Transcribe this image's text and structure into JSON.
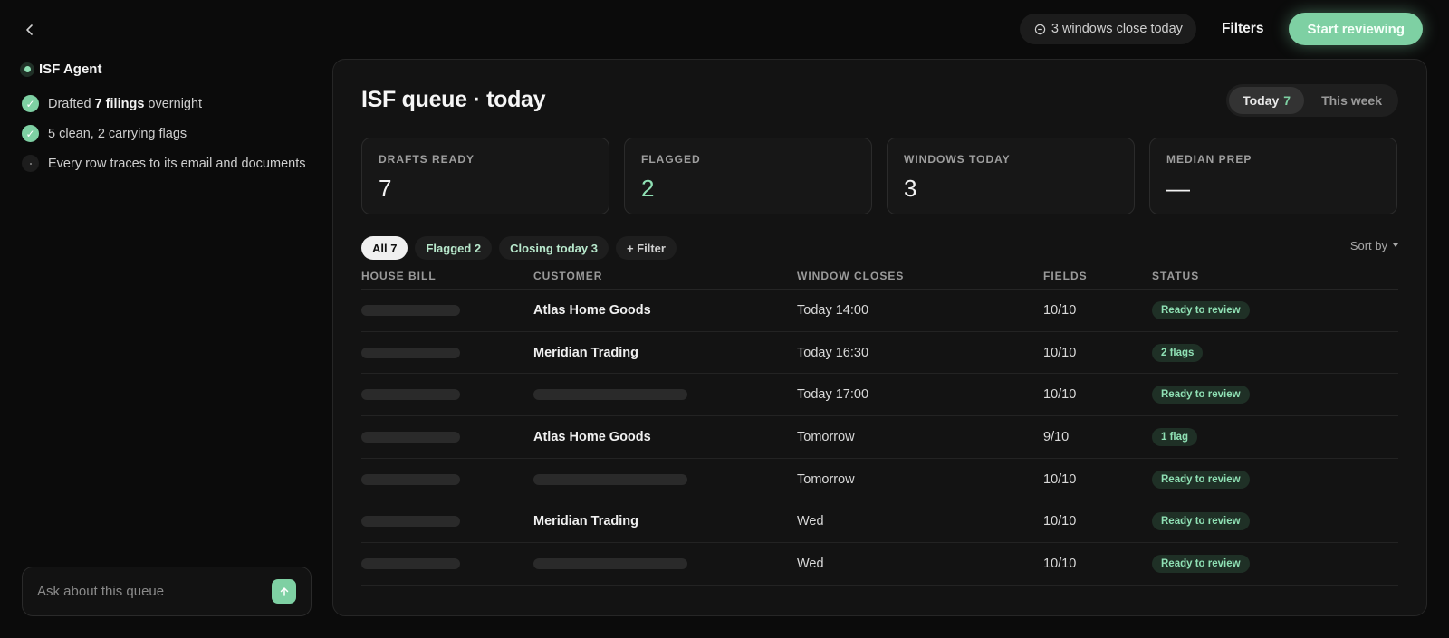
{
  "topbar": {
    "windows_info": "3 windows close today",
    "filters_label": "Filters",
    "start_label": "Start reviewing"
  },
  "sidebar": {
    "agent_name": "ISF Agent",
    "steps": [
      {
        "pre": "Drafted ",
        "bold": "7 filings",
        "post": " overnight"
      },
      {
        "text": "5 clean, 2 carrying flags"
      },
      {
        "text": "Every row traces to its email and documents"
      }
    ],
    "ask_placeholder": "Ask about this queue"
  },
  "panel": {
    "title": "ISF queue · today",
    "range": [
      {
        "label": "Today",
        "count": "7"
      },
      {
        "label": "This week",
        "count": ""
      }
    ],
    "stats": [
      {
        "label": "DRAFTS READY",
        "value": "7"
      },
      {
        "label": "FLAGGED",
        "value": "2"
      },
      {
        "label": "WINDOWS TODAY",
        "value": "3"
      },
      {
        "label": "MEDIAN PREP",
        "value": "—"
      }
    ],
    "chips": [
      "All 7",
      "Flagged 2",
      "Closing today 3",
      "+ Filter"
    ],
    "sort_label": "Sort by",
    "columns": [
      "HOUSE BILL",
      "CUSTOMER",
      "WINDOW CLOSES",
      "FIELDS",
      "STATUS"
    ],
    "rows": [
      {
        "customer": "Atlas Home Goods",
        "window": "Today 14:00",
        "fields": "10/10",
        "status": "Ready to review"
      },
      {
        "customer": "Meridian Trading",
        "window": "Today 16:30",
        "fields": "10/10",
        "status": "2 flags"
      },
      {
        "customer": "",
        "window": "Today 17:00",
        "fields": "10/10",
        "status": "Ready to review"
      },
      {
        "customer": "Atlas Home Goods",
        "window": "Tomorrow",
        "fields": "9/10",
        "status": "1 flag"
      },
      {
        "customer": "",
        "window": "Tomorrow",
        "fields": "10/10",
        "status": "Ready to review"
      },
      {
        "customer": "Meridian Trading",
        "window": "Wed",
        "fields": "10/10",
        "status": "Ready to review"
      },
      {
        "customer": "",
        "window": "Wed",
        "fields": "10/10",
        "status": "Ready to review"
      }
    ]
  },
  "colors": {
    "accent": "#7ed0a3",
    "badge_bg": "#1f3026",
    "badge_text": "#8fe0b4",
    "background": "#0b0b0b",
    "panel": "#131313"
  },
  "icons": {
    "back": "chevron-left-icon",
    "windows": "clock-icon",
    "send": "arrow-up-icon",
    "check": "check-icon",
    "sort": "caret-down-icon"
  }
}
